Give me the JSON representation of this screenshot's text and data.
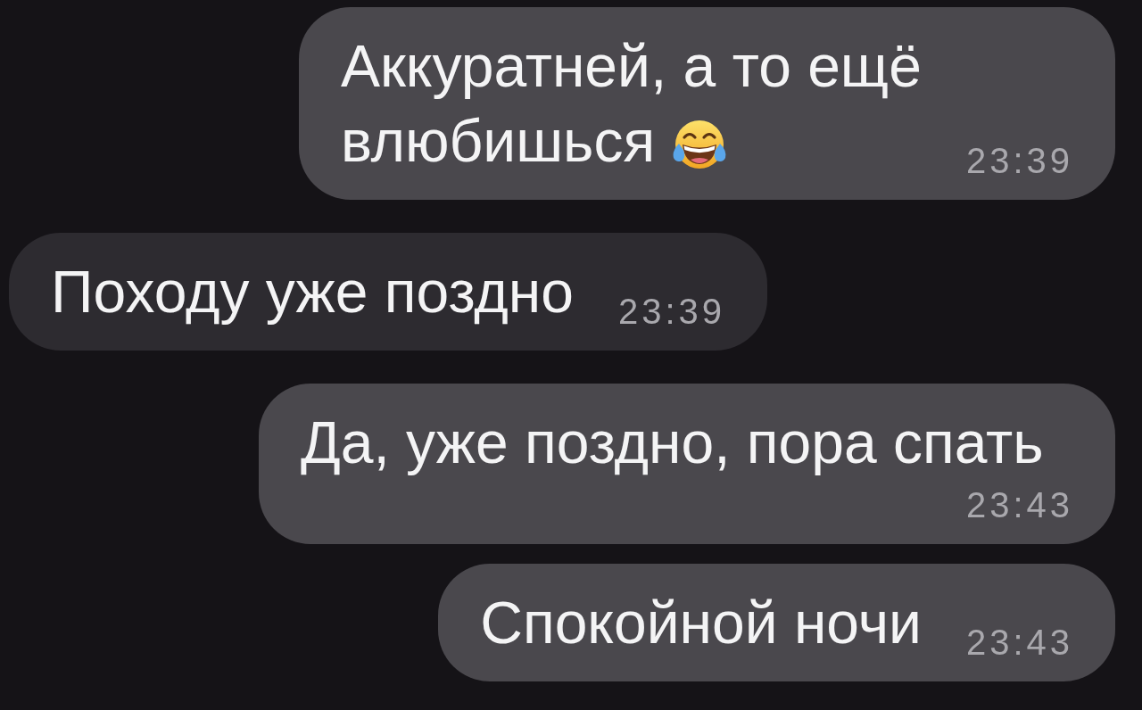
{
  "messages": [
    {
      "kind": "sent",
      "text": "Аккуратней, а то ещё\nвлюбишься",
      "emoji": true,
      "time": "23:39"
    },
    {
      "kind": "received",
      "text": "Походу уже поздно",
      "emoji": false,
      "time": "23:39"
    },
    {
      "kind": "sent",
      "text": "Да, уже поздно, пора спать",
      "emoji": false,
      "time": "23:43"
    },
    {
      "kind": "sent",
      "text": "Спокойной ночи",
      "emoji": false,
      "time": "23:43"
    }
  ]
}
